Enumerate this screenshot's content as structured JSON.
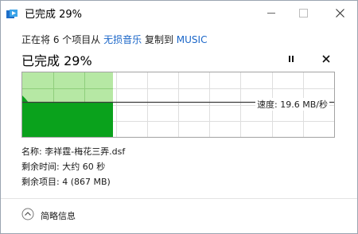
{
  "window": {
    "title": "已完成 29%",
    "controls": {
      "minimize": "minimize-icon",
      "maximize": "maximize-icon",
      "close": "close-icon"
    }
  },
  "header": {
    "desc_prefix": "正在将 6 个项目从",
    "source": "无损音乐",
    "desc_mid": "复制到",
    "destination": "MUSIC",
    "headline": "已完成 29%"
  },
  "actions": {
    "pause_icon": "pause-icon",
    "cancel_icon": "close-icon"
  },
  "progress": {
    "percent": 29,
    "fill_color": "#0aa21c",
    "bg_color": "#b6e8a4"
  },
  "graph": {
    "speed_label": "速度: 19.6 MB/秒",
    "current_speed_fraction": 0.54
  },
  "details": {
    "name_label": "名称:",
    "name_value": "李祥霆-梅花三弄.dsf",
    "time_label": "剩余时间:",
    "time_value": "大约 60 秒",
    "items_label": "剩余项目:",
    "items_value": "4 (867 MB)"
  },
  "footer": {
    "toggle_label": "简略信息",
    "toggle_icon": "chevron-up-icon"
  }
}
